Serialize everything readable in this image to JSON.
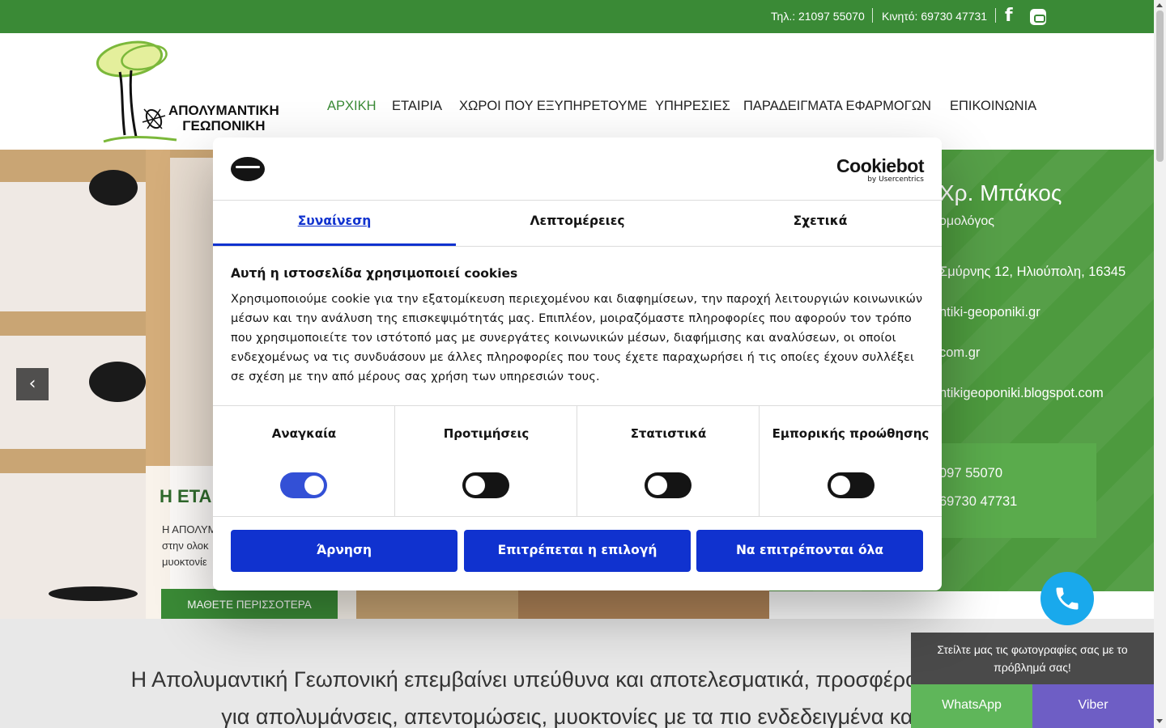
{
  "topbar": {
    "phone": "Τηλ.: 21097 55070",
    "mobile": "Κινητό: 69730 47731",
    "facebook_icon": "f"
  },
  "logo": {
    "line1": "ΑΠΟΛΥΜΑΝΤΙΚΗ",
    "line2": "ΓΕΩΠΟΝΙΚΗ"
  },
  "nav": [
    {
      "label": "ΑΡΧΙΚΗ",
      "active": true
    },
    {
      "label": "ΕΤΑΙΡΙΑ",
      "active": false
    },
    {
      "label": "ΧΩΡΟΙ ΠΟΥ ΕΞΥΠΗΡΕΤΟΥΜΕ",
      "active": false
    },
    {
      "label": "ΥΠΗΡΕΣΙΕΣ",
      "active": false
    },
    {
      "label": "ΠΑΡΑΔΕΙΓΜΑΤΑ ΕΦΑΡΜΟΓΩΝ",
      "active": false
    },
    {
      "label": "ΕΠΙΚΟΙΝΩΝΙΑ",
      "active": false
    }
  ],
  "hero": {
    "prev_arrow": "‹",
    "card_title": "Η ΕΤΑ",
    "card_text": [
      "Η ΑΠΟΛΥΜ",
      "στην ολοκ",
      "μυοκτονίε"
    ],
    "button": "ΜΑΘΕΤΕ ΠΕΡΙΣΣΟΤΕΡΑ"
  },
  "contact": {
    "name": "Χρ. Μπάκος",
    "role": "ομολόγος",
    "address": "Σμύρνης 12, Ηλιούπολη, 16345",
    "web": "ntiki-geoponiki.gr",
    "email": "com.gr",
    "blog": "ntikigeoponiki.blogspot.com",
    "phone": "097 55070",
    "mobile": "69730 47731"
  },
  "intro": {
    "line1": "Η Απολυμαντική Γεωπονική επεμβαίνει υπεύθυνα και αποτελεσματικά, προσφέροντας λύσεις",
    "line2": "για απολυμάνσεις, απεντομώσεις, μυοκτονίες με τα πιο ενδεδειγμένα και α"
  },
  "widget": {
    "message": "Στείλτε μας τις φωτογραφίες σας με το πρόβλημά σας!",
    "whatsapp": "WhatsApp",
    "viber": "Viber"
  },
  "cookie": {
    "brand": "Cookiebot",
    "brand_sub": "by Usercentrics",
    "tabs": [
      "Συναίνεση",
      "Λεπτομέρειες",
      "Σχετικά"
    ],
    "active_tab": 0,
    "title": "Αυτή η ιστοσελίδα χρησιμοποιεί cookies",
    "body": "Χρησιμοποιούμε cookie για την εξατομίκευση περιεχομένου και διαφημίσεων, την παροχή λειτουργιών κοινωνικών μέσων και την ανάλυση της επισκεψιμότητάς μας. Επιπλέον, μοιραζόμαστε πληροφορίες που αφορούν τον τρόπο που χρησιμοποιείτε τον ιστότοπό μας με συνεργάτες κοινωνικών μέσων, διαφήμισης και αναλύσεων, οι οποίοι ενδεχομένως να τις συνδυάσουν με άλλες πληροφορίες που τους έχετε παραχωρήσει ή τις οποίες έχουν συλλέξει σε σχέση με την από μέρους σας χρήση των υπηρεσιών τους.",
    "categories": [
      {
        "label": "Αναγκαία",
        "enabled": true
      },
      {
        "label": "Προτιμήσεις",
        "enabled": false
      },
      {
        "label": "Στατιστικά",
        "enabled": false
      },
      {
        "label": "Εμπορικής προώθησης",
        "enabled": false
      }
    ],
    "buttons": {
      "deny": "Άρνηση",
      "allow_selection": "Επιτρέπεται η επιλογή",
      "allow_all": "Να επιτρέπονται όλα"
    },
    "accent_color": "#1032cf"
  },
  "colors": {
    "brand_green": "#3a8a36",
    "panel_green": "#4d9a3e",
    "call_blue": "#19a9ec",
    "whatsapp": "#5fb65a",
    "viber": "#6e5ec5"
  }
}
